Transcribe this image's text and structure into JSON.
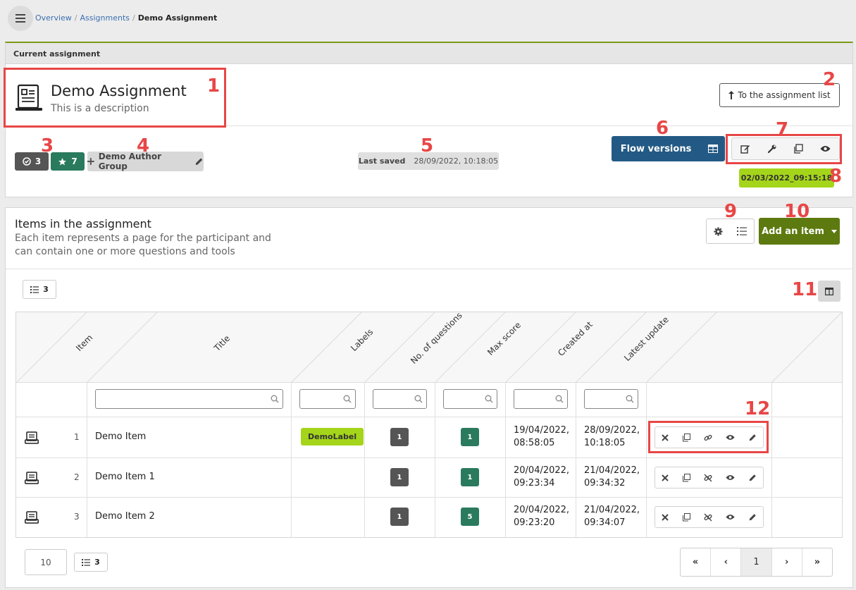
{
  "breadcrumb": {
    "items": [
      "Overview",
      "Assignments"
    ],
    "current": "Demo Assignment"
  },
  "current_assignment": {
    "header": "Current assignment",
    "title": "Demo Assignment",
    "description": "This is a description",
    "to_list_button": "To the assignment list",
    "badge_checks": "3",
    "badge_stars": "7",
    "author_group": "Demo Author Group",
    "last_saved_label": "Last saved",
    "last_saved_value": "28/09/2022, 10:18:05",
    "flow_versions_button": "Flow versions",
    "date_tag": "02/03/2022_09:15:18"
  },
  "items_panel": {
    "title": "Items in the assignment",
    "description": "Each item represents a page for the participant and can contain one or more questions and tools",
    "add_item_button": "Add an item",
    "item_count": "3"
  },
  "table": {
    "headers": [
      "Item",
      "Title",
      "Labels",
      "No. of questions",
      "Max score",
      "Created at",
      "Latest update"
    ],
    "rows": [
      {
        "num": "1",
        "title": "Demo Item",
        "label": "DemoLabel",
        "questions": "1",
        "max_score": "1",
        "created_date": "19/04/2022,",
        "created_time": "08:58:05",
        "updated_date": "28/09/2022,",
        "updated_time": "10:18:05"
      },
      {
        "num": "2",
        "title": "Demo Item 1",
        "label": "",
        "questions": "1",
        "max_score": "1",
        "created_date": "20/04/2022,",
        "created_time": "09:23:34",
        "updated_date": "21/04/2022,",
        "updated_time": "09:34:32"
      },
      {
        "num": "3",
        "title": "Demo Item 2",
        "label": "",
        "questions": "1",
        "max_score": "5",
        "created_date": "20/04/2022,",
        "created_time": "09:23:20",
        "updated_date": "21/04/2022,",
        "updated_time": "09:34:07"
      }
    ]
  },
  "pagination": {
    "page_size": "10",
    "count": "3",
    "first": "«",
    "prev": "‹",
    "current_page": "1",
    "next": "›",
    "last": "»"
  },
  "annotations": [
    "1",
    "2",
    "3",
    "4",
    "5",
    "6",
    "7",
    "8",
    "9",
    "10",
    "11",
    "12"
  ],
  "colors": {
    "accent_green": "#a4d51a",
    "dark_green": "#5d7a10",
    "teal": "#2a7a5e",
    "navy": "#235a85",
    "annotation_red": "#e84646",
    "link_blue": "#3b6fb0"
  }
}
